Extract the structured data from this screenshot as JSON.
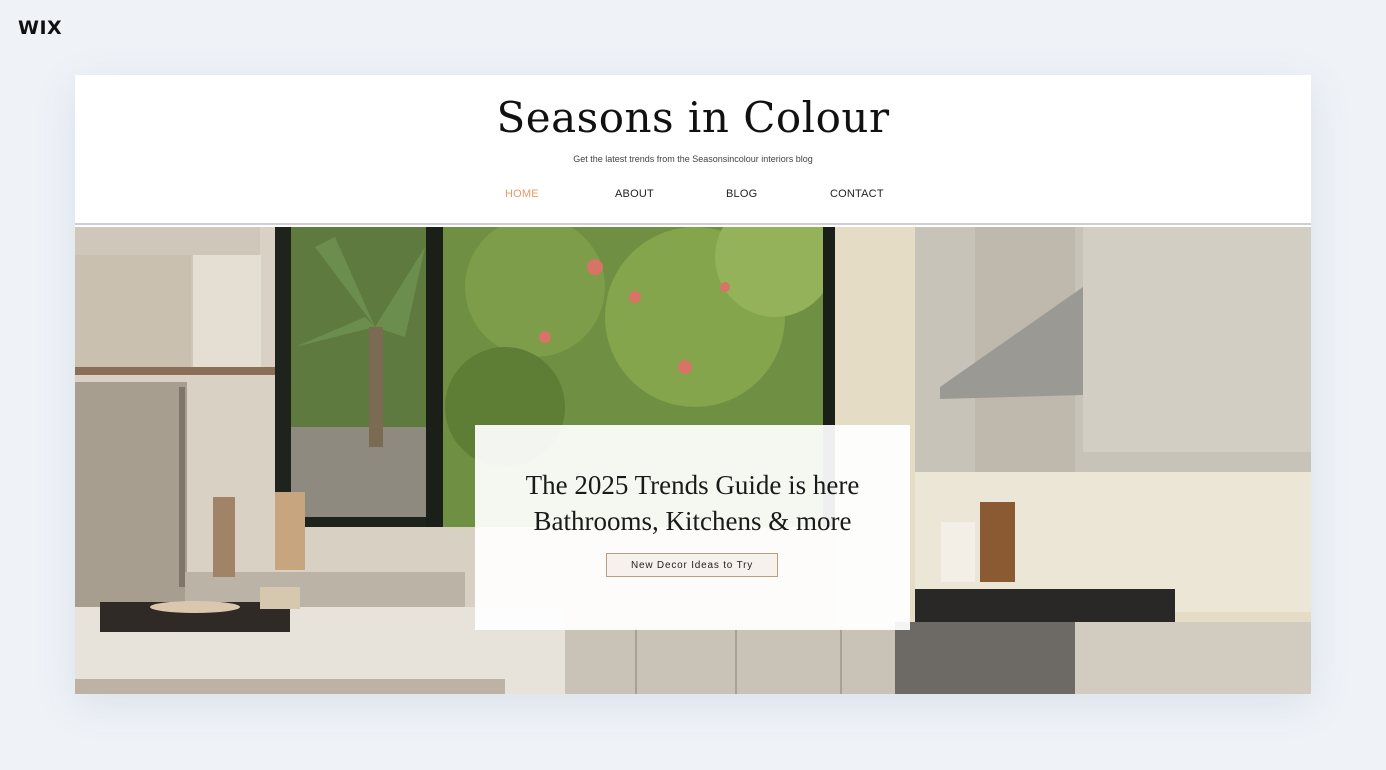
{
  "platform": {
    "logo_text": "WIX"
  },
  "site": {
    "title": "Seasons in Colour",
    "tagline": "Get the latest trends from the Seasonsincolour interiors blog",
    "nav": [
      {
        "label": "HOME",
        "active": true
      },
      {
        "label": "ABOUT",
        "active": false
      },
      {
        "label": "BLOG",
        "active": false
      },
      {
        "label": "CONTACT",
        "active": false
      }
    ]
  },
  "hero": {
    "headline_line1": "The 2025 Trends Guide is here",
    "headline_line2": "Bathrooms, Kitchens & more",
    "cta_label": "New Decor Ideas to Try",
    "image_description": "kitchen-interior-photo"
  },
  "colors": {
    "page_background": "#eff3f8",
    "nav_active": "#e59a64",
    "cta_border": "#b89f83"
  }
}
